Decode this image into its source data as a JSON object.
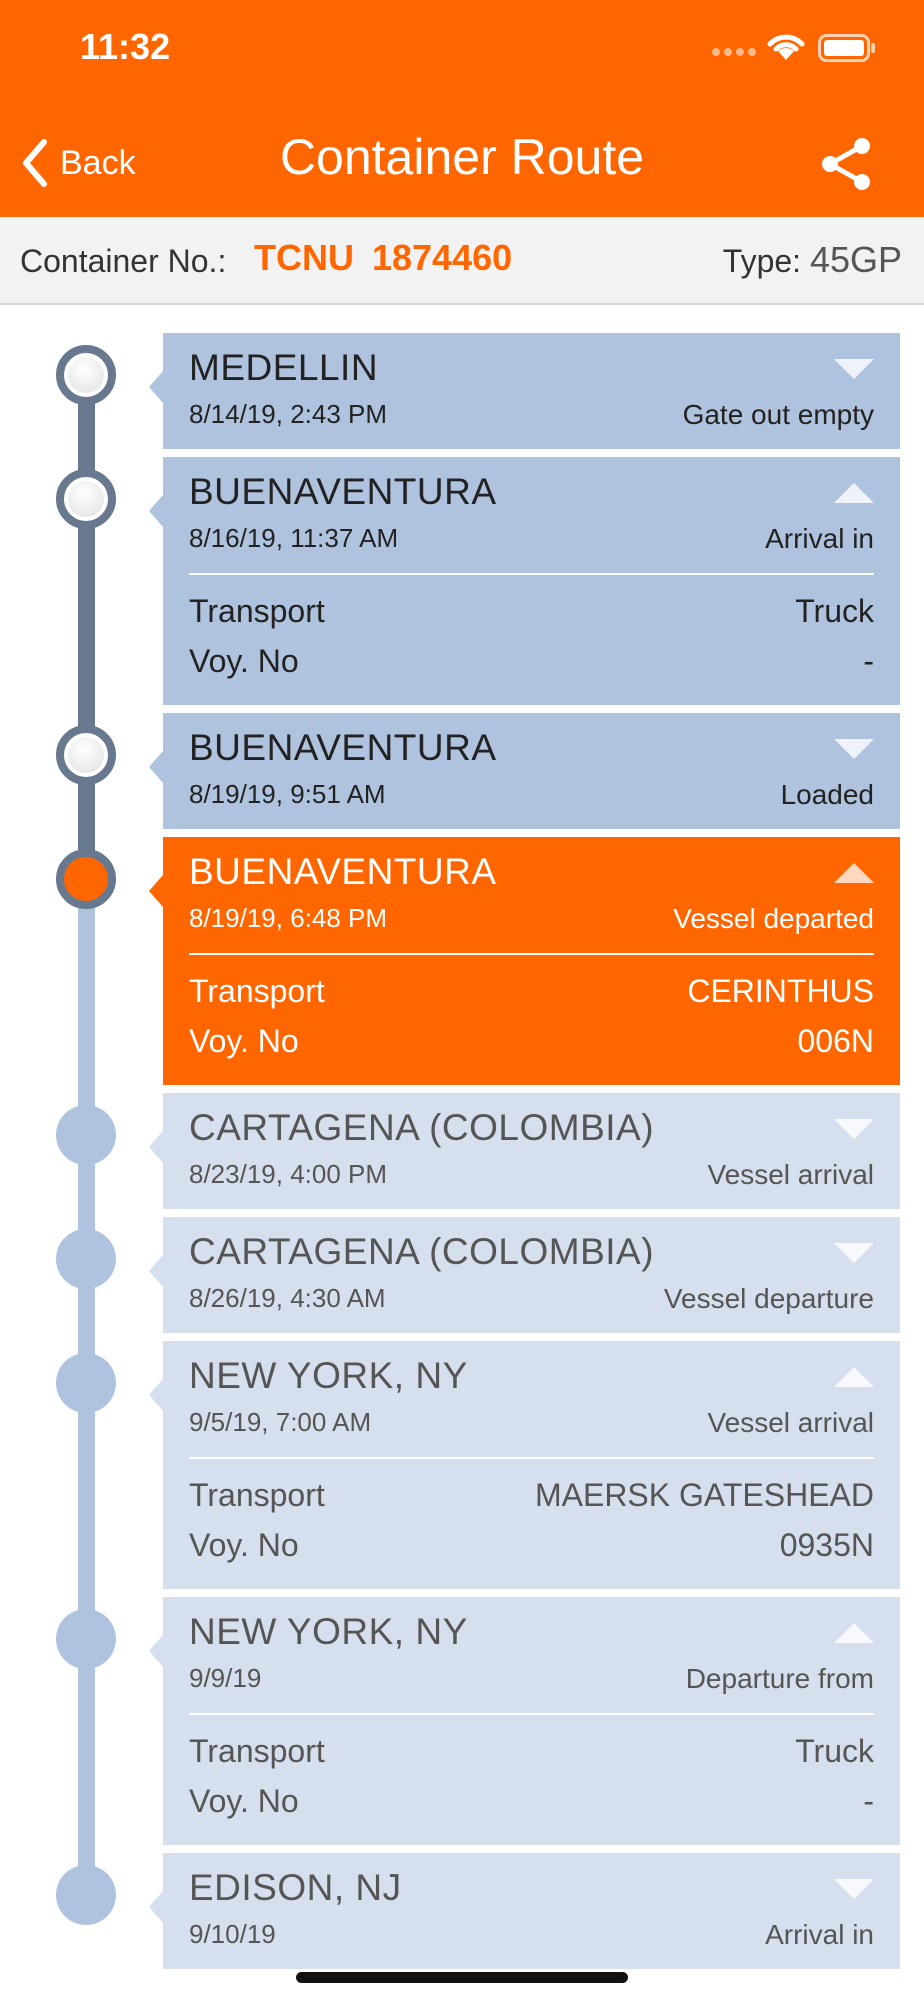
{
  "status_bar": {
    "time": "11:32"
  },
  "nav": {
    "back_label": "Back",
    "title": "Container Route"
  },
  "info": {
    "container_label": "Container No.:",
    "container_no": "TCNU  1874460",
    "type_label": "Type:",
    "type_value": "45GP"
  },
  "detail_labels": {
    "transport": "Transport",
    "voyage": "Voy. No"
  },
  "colors": {
    "accent": "#FF6600",
    "done_card": "#AFC3DE",
    "future_card": "#D5DFEE",
    "done_line": "#68788E",
    "future_line": "#AFC3DE"
  },
  "events": [
    {
      "location": "MEDELLIN",
      "date": "8/14/19, 2:43 PM",
      "event": "Gate out empty",
      "state": "done",
      "expanded": false
    },
    {
      "location": "BUENAVENTURA",
      "date": "8/16/19, 11:37 AM",
      "event": "Arrival in",
      "state": "done",
      "expanded": true,
      "transport": "Truck",
      "voyage": "-"
    },
    {
      "location": "BUENAVENTURA",
      "date": "8/19/19, 9:51 AM",
      "event": "Loaded",
      "state": "done",
      "expanded": false
    },
    {
      "location": "BUENAVENTURA",
      "date": "8/19/19, 6:48 PM",
      "event": "Vessel departed",
      "state": "current",
      "expanded": true,
      "transport": "CERINTHUS",
      "voyage": "006N"
    },
    {
      "location": "CARTAGENA (COLOMBIA)",
      "date": "8/23/19, 4:00 PM",
      "event": "Vessel arrival",
      "state": "future",
      "expanded": false
    },
    {
      "location": "CARTAGENA (COLOMBIA)",
      "date": "8/26/19, 4:30 AM",
      "event": "Vessel departure",
      "state": "future",
      "expanded": false
    },
    {
      "location": "NEW YORK, NY",
      "date": "9/5/19, 7:00 AM",
      "event": "Vessel arrival",
      "state": "future",
      "expanded": true,
      "transport": "MAERSK GATESHEAD",
      "voyage": "0935N"
    },
    {
      "location": "NEW YORK, NY",
      "date": "9/9/19",
      "event": "Departure from",
      "state": "future",
      "expanded": true,
      "transport": "Truck",
      "voyage": "-"
    },
    {
      "location": "EDISON, NJ",
      "date": "9/10/19",
      "event": "Arrival in",
      "state": "future",
      "expanded": false
    }
  ]
}
